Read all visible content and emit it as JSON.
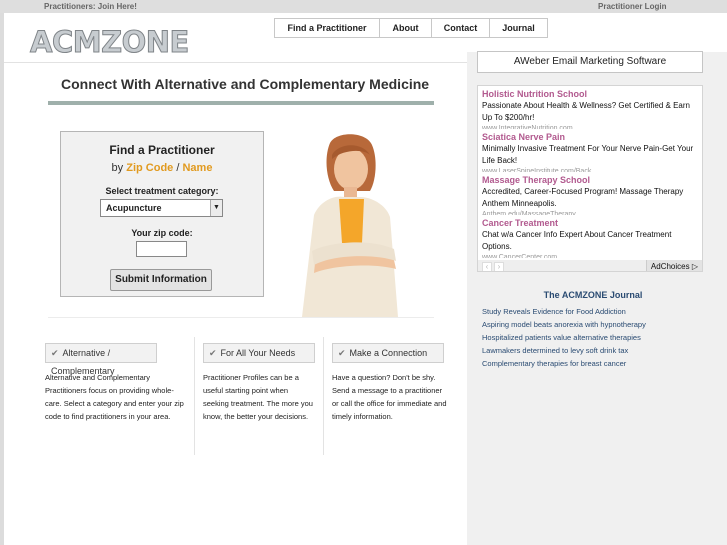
{
  "topbar": {
    "join": "Practitioners: Join Here!",
    "login": "Practitioner Login"
  },
  "logo": "ACMZONE",
  "nav": [
    "Find a Practitioner",
    "About",
    "Contact",
    "Journal"
  ],
  "main": {
    "title": "Connect With Alternative and Complementary Medicine"
  },
  "finder": {
    "title": "Find a Practitioner",
    "by": "by",
    "zip_link": "Zip Code",
    "slash": "/",
    "name_link": "Name",
    "category_label": "Select treatment category:",
    "category_value": "Acupuncture",
    "zip_label": "Your zip code:",
    "zip_value": "",
    "submit": "Submit Information"
  },
  "features": [
    {
      "label": "Alternative / Complementary",
      "text": "Alternative and Complementary Practitioners focus on providing whole-care. Select a category and enter your zip code to find practitioners in your area."
    },
    {
      "label": "For All Your Needs",
      "text": "Practitioner Profiles can be a useful starting point when seeking treatment. The more you know, the better your decisions."
    },
    {
      "label": "Make a Connection",
      "text": "Have a question? Don't be shy. Send a message to a practitioner or call the office for immediate and timely information."
    }
  ],
  "sidebar": {
    "aweber": "AWeber Email Marketing Software",
    "ads": [
      {
        "title": "Holistic Nutrition School",
        "body": "Passionate About Health & Wellness? Get Certified & Earn Up To $200/hr!",
        "url": "www.IntegrativeNutrition.com"
      },
      {
        "title": "Sciatica Nerve Pain",
        "body": "Minimally Invasive Treatment For Your Nerve Pain-Get Your Life Back!",
        "url": "www.LaserSpineInstitute.com/Back"
      },
      {
        "title": "Massage Therapy School",
        "body": "Accredited, Career-Focused Program! Massage Therapy Anthem Minneapolis.",
        "url": "Anthem.edu/MassageTherapy"
      },
      {
        "title": "Cancer Treatment",
        "body": "Chat w/a Cancer Info Expert About Cancer Treatment Options.",
        "url": "www.CancerCenter.com"
      }
    ],
    "adchoices": "AdChoices",
    "journal_title": "The ACMZONE Journal",
    "journal_links": [
      "Study Reveals Evidence for Food Addiction",
      "Aspiring model beats anorexia with hypnotherapy",
      "Hospitalized patients value alternative therapies",
      "Lawmakers determined to levy soft drink tax",
      "Complementary therapies for breast cancer"
    ]
  },
  "colors": {
    "accent_orange": "#e19a1f",
    "ad_title": "#b25a8f",
    "journal_blue": "#2a4b72",
    "rule": "#9fb0ab"
  }
}
